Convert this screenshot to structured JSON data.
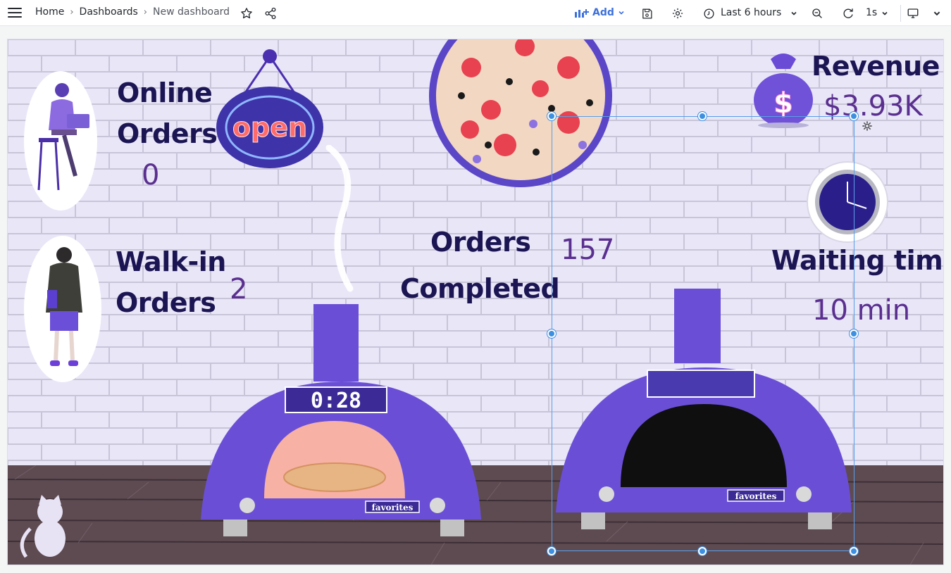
{
  "topbar": {
    "breadcrumb": [
      "Home",
      "Dashboards",
      "New dashboard"
    ],
    "separator": "›",
    "add_label": "Add",
    "time_range": "Last 6 hours",
    "refresh_interval": "1s"
  },
  "panels": {
    "online_orders": {
      "label_line1": "Online",
      "label_line2": "Orders",
      "value": "0"
    },
    "walkin_orders": {
      "label_line1": "Walk-in",
      "label_line2": "Orders",
      "value": "2"
    },
    "orders_completed": {
      "label_line1": "Orders",
      "label_line2": "Completed",
      "value": "157"
    },
    "revenue": {
      "label": "Revenue",
      "value": "$3.93K"
    },
    "waiting_time": {
      "label": "Waiting time",
      "value": "10 min"
    }
  },
  "scene": {
    "open_sign": "open",
    "oven_timer": "0:28",
    "oven1_brand": "favorites",
    "oven2_brand": "favorites"
  },
  "colors": {
    "accent": "#3d71d9",
    "selection": "#3d8fe0",
    "label_dark": "#1b1553",
    "value_purple": "#5a2f8f",
    "oven_purple": "#6a4fd6",
    "wall": "#e8e6f7",
    "floor": "#5e4b52"
  }
}
